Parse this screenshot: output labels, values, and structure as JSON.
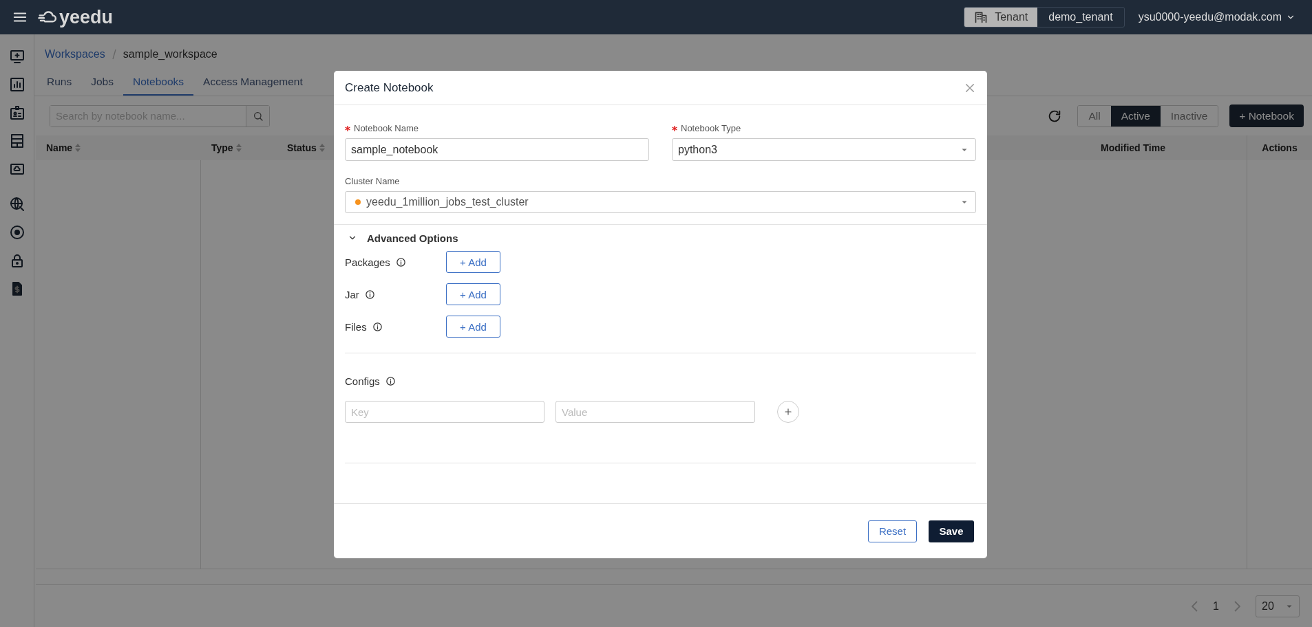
{
  "header": {
    "brand": "yeedu",
    "tenant_label": "Tenant",
    "tenant": "demo_tenant",
    "user": "ysu0000-yeedu@modak.com"
  },
  "breadcrumb": [
    {
      "label": "Workspaces",
      "kind": "link"
    },
    {
      "label": "sample_workspace",
      "kind": "current"
    }
  ],
  "tabs": [
    {
      "label": "Runs",
      "selected": false
    },
    {
      "label": "Jobs",
      "selected": false
    },
    {
      "label": "Notebooks",
      "selected": true
    },
    {
      "label": "Access Management",
      "selected": false
    }
  ],
  "search": {
    "placeholder": "Search by notebook name..."
  },
  "filters": [
    {
      "label": "All",
      "selected": false
    },
    {
      "label": "Active",
      "selected": true
    },
    {
      "label": "Inactive",
      "selected": false
    }
  ],
  "new_button": "+ Notebook",
  "table": {
    "columns": [
      {
        "label": "Name",
        "sortable": true
      },
      {
        "label": "Type",
        "sortable": true
      },
      {
        "label": "Status",
        "sortable": true
      },
      {
        "label": "Modified Time",
        "sortable": false
      },
      {
        "label": "Actions",
        "sortable": false
      }
    ]
  },
  "pagination": {
    "page": "1",
    "page_size": "20"
  },
  "modal": {
    "title": "Create Notebook",
    "notebook_name": {
      "label": "Notebook Name",
      "required": true,
      "value": "sample_notebook"
    },
    "notebook_type": {
      "label": "Notebook Type",
      "required": true,
      "value": "python3"
    },
    "cluster": {
      "label": "Cluster Name",
      "value": "yeedu_1million_jobs_test_cluster",
      "color": "#f7931e"
    },
    "advanced": {
      "label": "Advanced Options",
      "expanded": true,
      "items": [
        {
          "label": "Packages",
          "button": "+ Add"
        },
        {
          "label": "Jar",
          "button": "+ Add"
        },
        {
          "label": "Files",
          "button": "+ Add"
        }
      ]
    },
    "configs": {
      "label": "Configs",
      "key_placeholder": "Key",
      "value_placeholder": "Value"
    },
    "buttons": {
      "reset": "Reset",
      "save": "Save"
    }
  }
}
